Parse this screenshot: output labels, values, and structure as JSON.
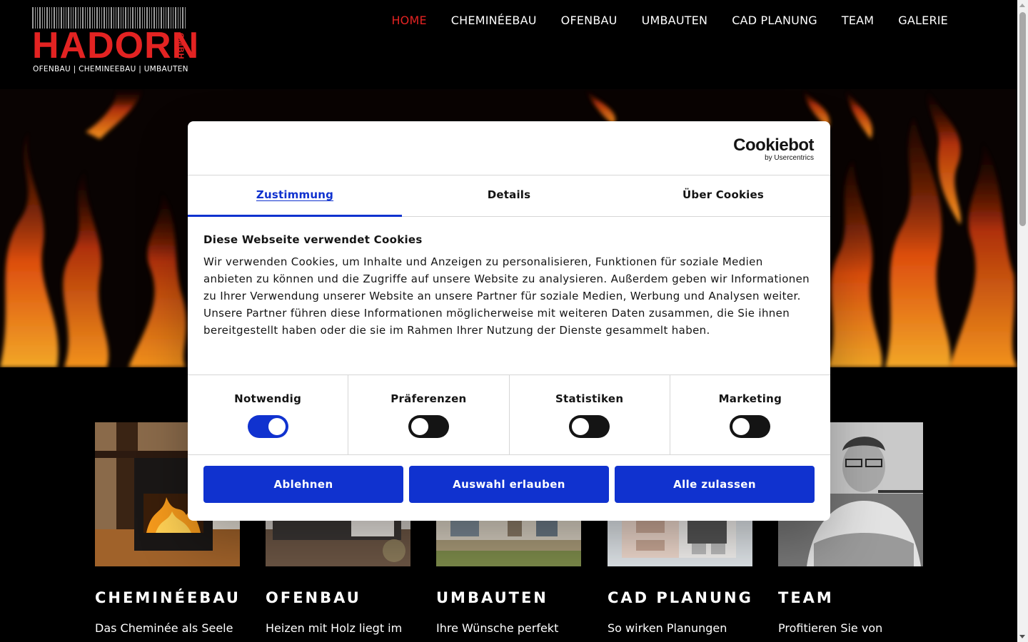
{
  "logo": {
    "wordmark": "HADORN",
    "suffix": "GMBH",
    "tagline": "OFENBAU | CHEMINEEBAU | UMBAUTEN",
    "color": "#e32322"
  },
  "nav": {
    "items": [
      "HOME",
      "CHEMINÉEBAU",
      "OFENBAU",
      "UMBAUTEN",
      "CAD PLANUNG",
      "TEAM",
      "GALERIE"
    ],
    "active": "HOME",
    "active_color": "#e32322"
  },
  "cookie_dialog": {
    "brand": "Cookiebot",
    "brand_sub": "by Usercentrics",
    "tabs": [
      "Zustimmung",
      "Details",
      "Über Cookies"
    ],
    "active_tab": "Zustimmung",
    "heading": "Diese Webseite verwendet Cookies",
    "body": "Wir verwenden Cookies, um Inhalte und Anzeigen zu personalisieren, Funktionen für soziale Medien anbieten zu können und die Zugriffe auf unsere Website zu analysieren. Außerdem geben wir Informationen zu Ihrer Verwendung unserer Website an unsere Partner für soziale Medien, Werbung und Analysen weiter. Unsere Partner führen diese Informationen möglicherweise mit weiteren Daten zusammen, die Sie ihnen bereitgestellt haben oder die sie im Rahmen Ihrer Nutzung der Dienste gesammelt haben.",
    "categories": [
      {
        "label": "Notwendig",
        "enabled": true
      },
      {
        "label": "Präferenzen",
        "enabled": false
      },
      {
        "label": "Statistiken",
        "enabled": false
      },
      {
        "label": "Marketing",
        "enabled": false
      }
    ],
    "buttons": {
      "reject": "Ablehnen",
      "allow_selection": "Auswahl erlauben",
      "allow_all": "Alle zulassen"
    },
    "accent_color": "#1032cf"
  },
  "cards": [
    {
      "title": "CHEMINÉEBAU",
      "text": "Das Cheminée als Seele",
      "image": "fireplace-photo"
    },
    {
      "title": "OFENBAU",
      "text": "Heizen mit Holz liegt im",
      "image": "stove-photo"
    },
    {
      "title": "UMBAUTEN",
      "text": "Ihre Wünsche perfekt",
      "image": "house-photo"
    },
    {
      "title": "CAD PLANUNG",
      "text": "So wirken Planungen",
      "image": "cad-model-photo"
    },
    {
      "title": "TEAM",
      "text": "Profitieren Sie von",
      "image": "team-portrait-photo"
    }
  ]
}
